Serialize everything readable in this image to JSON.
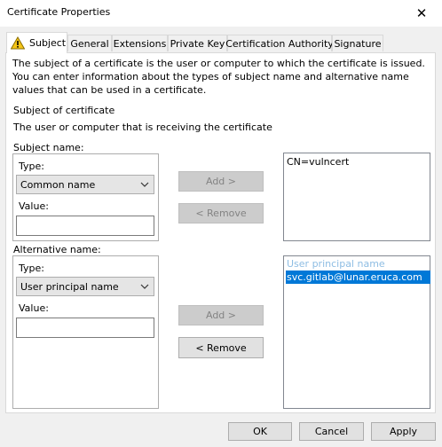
{
  "window": {
    "title": "Certificate Properties"
  },
  "tabs": [
    {
      "label": "Subject"
    },
    {
      "label": "General"
    },
    {
      "label": "Extensions"
    },
    {
      "label": "Private Key"
    },
    {
      "label": "Certification Authority"
    },
    {
      "label": "Signature"
    }
  ],
  "description": "The subject of a certificate is the user or computer to which the certificate is issued. You can enter information about the types of subject name and alternative name values that can be used in a certificate.",
  "subject_of_certificate": {
    "heading": "Subject of certificate",
    "text": "The user or computer that is receiving the certificate"
  },
  "subject_name": {
    "label": "Subject name:",
    "type_label": "Type:",
    "type_value": "Common name",
    "value_label": "Value:",
    "value": "",
    "add_label": "Add >",
    "remove_label": "< Remove",
    "list": [
      "CN=vulncert"
    ]
  },
  "alternative_name": {
    "label": "Alternative name:",
    "type_label": "Type:",
    "type_value": "User principal name",
    "value_label": "Value:",
    "value": "",
    "add_label": "Add >",
    "remove_label": "< Remove",
    "list_header": "User principal name",
    "list": [
      "svc.gitlab@lunar.eruca.com"
    ]
  },
  "footer": {
    "ok_label": "OK",
    "cancel_label": "Cancel",
    "apply_label": "Apply"
  },
  "colors": {
    "selection": "#0078d7",
    "warning_icon": "#f5c518"
  }
}
